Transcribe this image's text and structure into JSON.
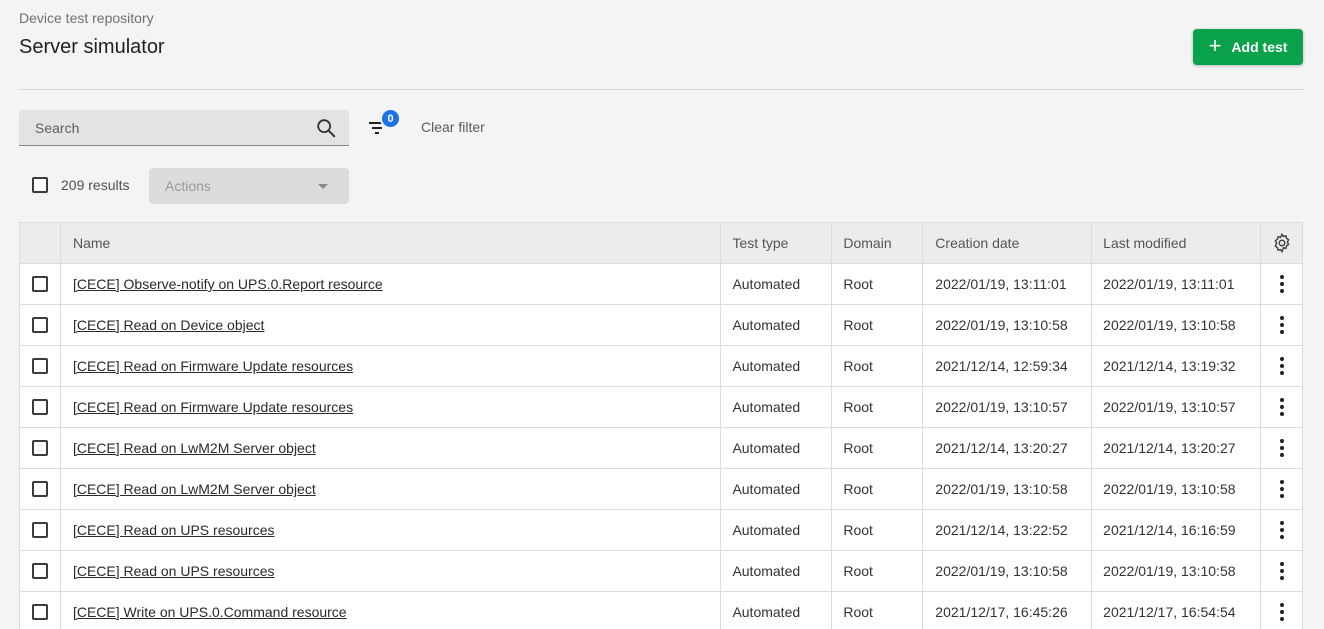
{
  "header": {
    "breadcrumb": "Device test repository",
    "title": "Server simulator",
    "add_button_label": "Add test"
  },
  "toolbar": {
    "search_placeholder": "Search",
    "filter_count": "0",
    "clear_filter_label": "Clear filter",
    "results_label": "209 results",
    "actions_label": "Actions"
  },
  "table": {
    "columns": {
      "name": "Name",
      "test_type": "Test type",
      "domain": "Domain",
      "creation_date": "Creation date",
      "last_modified": "Last modified"
    },
    "rows": [
      {
        "name": "[CECE] Observe-notify on UPS.0.Report resource",
        "type": "Automated",
        "domain": "Root",
        "created": "2022/01/19, 13:11:01",
        "modified": "2022/01/19, 13:11:01"
      },
      {
        "name": "[CECE] Read on Device object",
        "type": "Automated",
        "domain": "Root",
        "created": "2022/01/19, 13:10:58",
        "modified": "2022/01/19, 13:10:58"
      },
      {
        "name": "[CECE] Read on Firmware Update resources",
        "type": "Automated",
        "domain": "Root",
        "created": "2021/12/14, 12:59:34",
        "modified": "2021/12/14, 13:19:32"
      },
      {
        "name": "[CECE] Read on Firmware Update resources",
        "type": "Automated",
        "domain": "Root",
        "created": "2022/01/19, 13:10:57",
        "modified": "2022/01/19, 13:10:57"
      },
      {
        "name": "[CECE] Read on LwM2M Server object",
        "type": "Automated",
        "domain": "Root",
        "created": "2021/12/14, 13:20:27",
        "modified": "2021/12/14, 13:20:27"
      },
      {
        "name": "[CECE] Read on LwM2M Server object",
        "type": "Automated",
        "domain": "Root",
        "created": "2022/01/19, 13:10:58",
        "modified": "2022/01/19, 13:10:58"
      },
      {
        "name": "[CECE] Read on UPS resources",
        "type": "Automated",
        "domain": "Root",
        "created": "2021/12/14, 13:22:52",
        "modified": "2021/12/14, 16:16:59"
      },
      {
        "name": "[CECE] Read on UPS resources",
        "type": "Automated",
        "domain": "Root",
        "created": "2022/01/19, 13:10:58",
        "modified": "2022/01/19, 13:10:58"
      },
      {
        "name": "[CECE] Write on UPS.0.Command resource",
        "type": "Automated",
        "domain": "Root",
        "created": "2021/12/17, 16:45:26",
        "modified": "2021/12/17, 16:54:54"
      }
    ]
  },
  "colors": {
    "accent": "#0aa14b",
    "badge": "#1a73e8"
  },
  "icons": [
    "plus-icon",
    "search-icon",
    "filter-icon",
    "chevron-down-icon",
    "gear-icon",
    "more-vert-icon"
  ]
}
